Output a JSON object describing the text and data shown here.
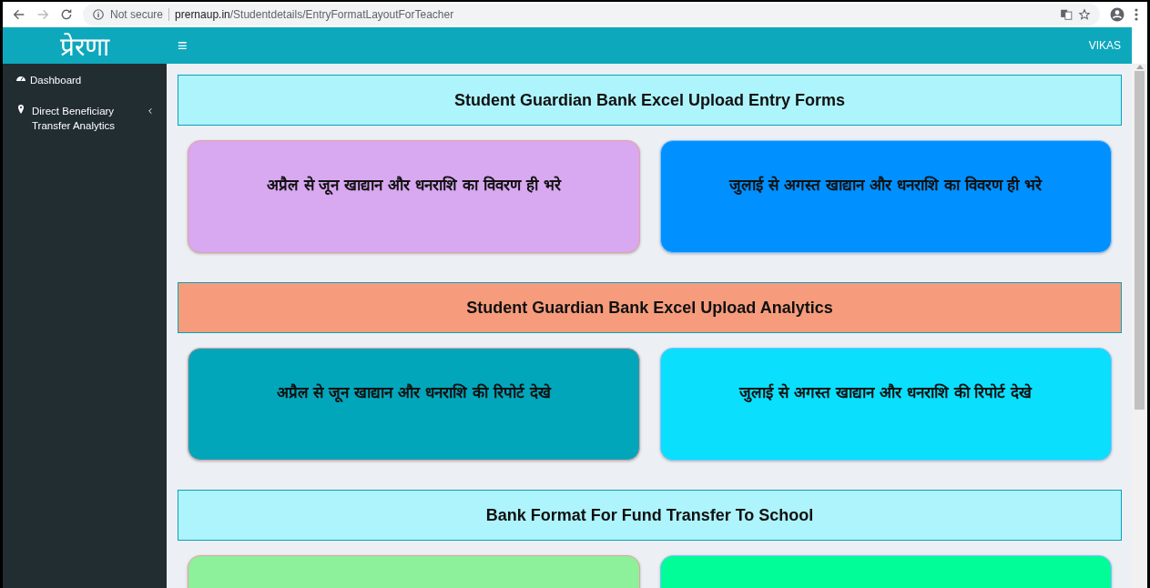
{
  "browser": {
    "security": "Not secure",
    "host": "prernaup.in",
    "path": "/Studentdetails/EntryFormatLayoutForTeacher"
  },
  "header": {
    "logo": "प्रेरणा",
    "menu_glyph": "≡",
    "user": "VIKAS"
  },
  "sidebar": {
    "items": [
      {
        "label": "Dashboard",
        "kind": "link"
      },
      {
        "label": "Direct Beneficiary Transfer Analytics",
        "kind": "treeview",
        "expanded": false
      }
    ]
  },
  "sections": [
    {
      "title": "Student Guardian Bank Excel Upload Entry Forms",
      "color": "#adf4fd",
      "cards": [
        {
          "label": "अप्रैल से जून खाद्यान और धनराशि का विवरण ही भरे",
          "color": "#d8a8f0"
        },
        {
          "label": "जुलाई से अगस्त खाद्यान और धनराशि का विवरण ही भरे",
          "color": "#0090ff"
        }
      ]
    },
    {
      "title": "Student Guardian Bank Excel Upload Analytics",
      "color": "#f69c7c",
      "cards": [
        {
          "label": "अप्रैल से जून खाद्यान और धनराशि की रिपोर्ट देखे",
          "color": "#02a6ba"
        },
        {
          "label": "जुलाई से अगस्त खाद्यान और धनराशि की रिपोर्ट देखे",
          "color": "#0adffd"
        }
      ]
    },
    {
      "title": "Bank Format For Fund Transfer To School",
      "color": "#adf4fd",
      "cards": [
        {
          "color": "#8cf19a"
        },
        {
          "color": "#00fd98"
        }
      ]
    }
  ]
}
